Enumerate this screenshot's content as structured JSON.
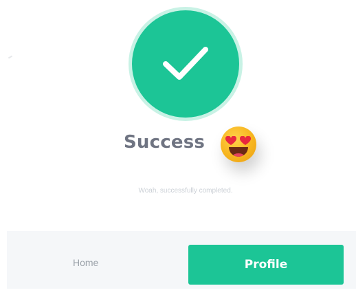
{
  "success_dialog": {
    "title": "Success",
    "message": "Woah, successfully completed.",
    "check_icon": "checkmark-icon",
    "emoji_icon": "heart-eyes-emoji-icon"
  },
  "actions": {
    "home_label": "Home",
    "profile_label": "Profile"
  },
  "colors": {
    "accent": "#1cc596",
    "title_text": "#6f7482",
    "bar_background": "#f5f7f9"
  }
}
